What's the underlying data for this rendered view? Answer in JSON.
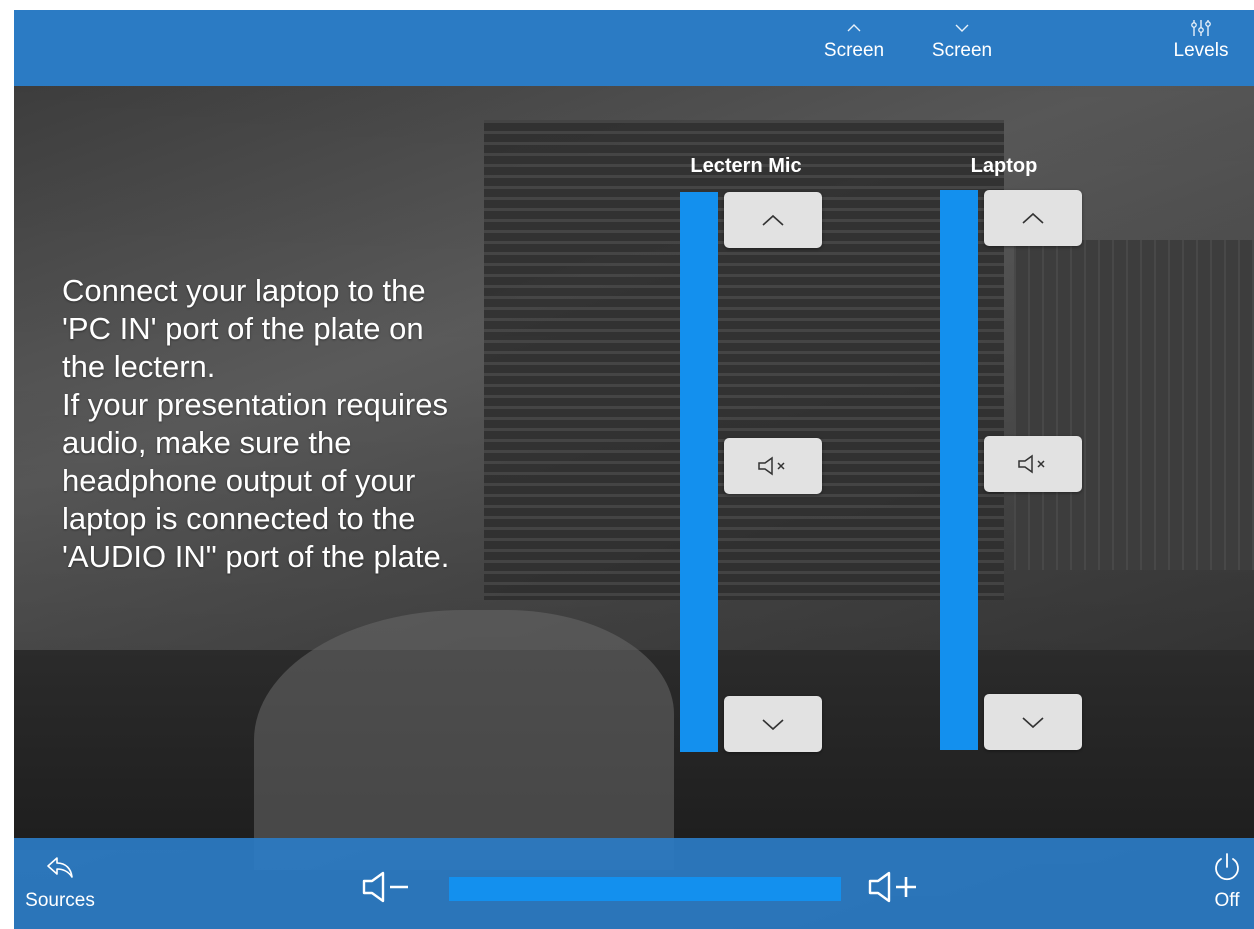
{
  "topbar": {
    "screen_up": {
      "label": "Screen",
      "icon": "chevron-up-icon"
    },
    "screen_down": {
      "label": "Screen",
      "icon": "chevron-down-icon"
    },
    "levels": {
      "label": "Levels",
      "icon": "sliders-icon"
    }
  },
  "instructions": {
    "lines": [
      "Connect your laptop to the",
      "'PC IN' port of the plate on",
      "the lectern.",
      "If your presentation requires",
      "audio, make sure the",
      "headphone output of your",
      "laptop is connected to the",
      "'AUDIO IN\" port of the plate."
    ]
  },
  "channels": [
    {
      "title": "Lectern Mic",
      "level": 1.0,
      "up_icon": "chevron-up-icon",
      "mute_icon": "speaker-mute-icon",
      "down_icon": "chevron-down-icon"
    },
    {
      "title": "Laptop",
      "level": 1.0,
      "up_icon": "chevron-up-icon",
      "mute_icon": "speaker-mute-icon",
      "down_icon": "chevron-down-icon"
    }
  ],
  "bottombar": {
    "sources": {
      "label": "Sources",
      "icon": "back-arrow-icon"
    },
    "volume_down_icon": "volume-down-icon",
    "volume_up_icon": "volume-up-icon",
    "volume_level": 1.0,
    "off": {
      "label": "Off",
      "icon": "power-icon"
    }
  },
  "colors": {
    "accent": "#1390ee",
    "bar": "#2b7bc4",
    "button": "#e2e2e2"
  }
}
